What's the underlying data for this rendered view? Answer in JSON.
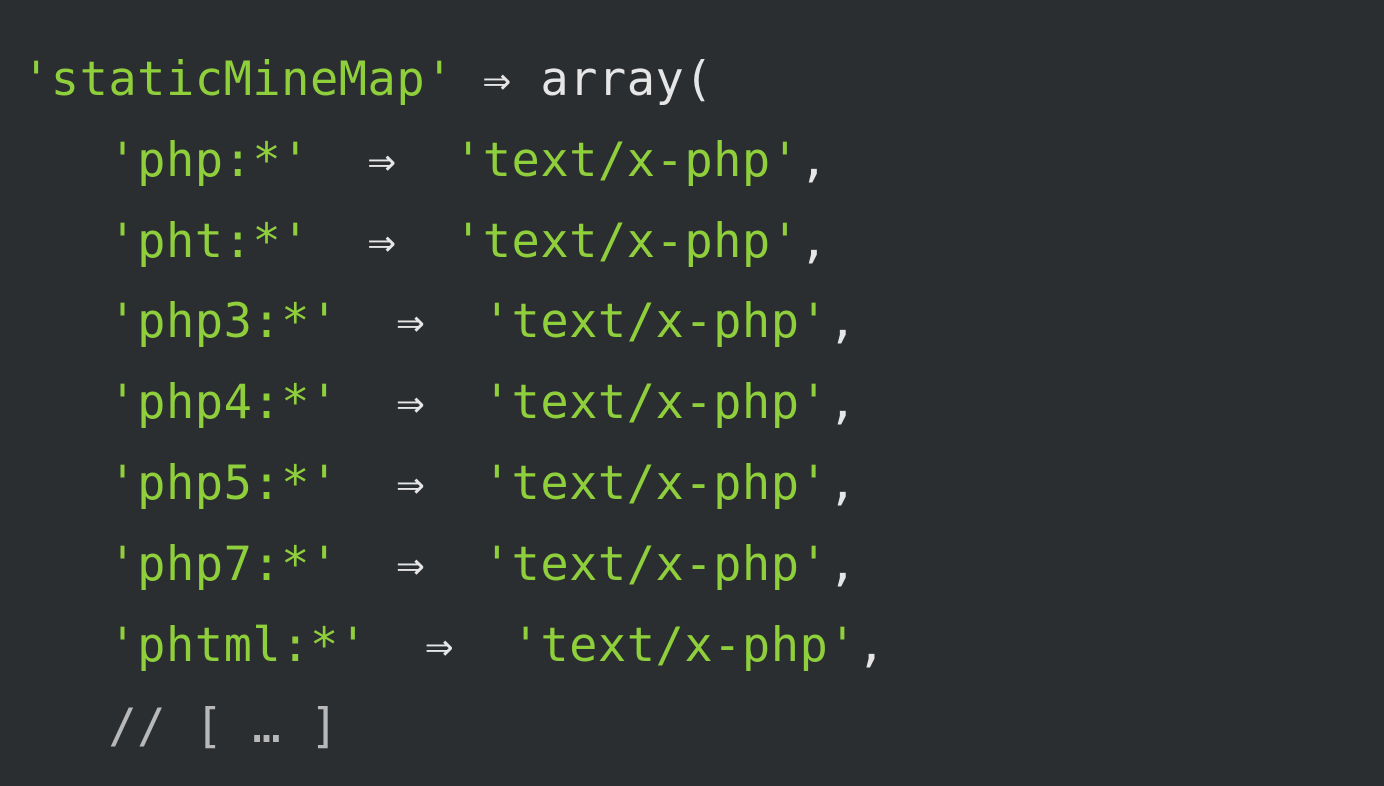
{
  "code": {
    "key": "'staticMineMap'",
    "arrow": "⇒",
    "array_kw": "array",
    "open_paren": "(",
    "entries": [
      {
        "k": "'php:*'",
        "v": "'text/x-php'"
      },
      {
        "k": "'pht:*'",
        "v": "'text/x-php'"
      },
      {
        "k": "'php3:*'",
        "v": "'text/x-php'"
      },
      {
        "k": "'php4:*'",
        "v": "'text/x-php'"
      },
      {
        "k": "'php5:*'",
        "v": "'text/x-php'"
      },
      {
        "k": "'php7:*'",
        "v": "'text/x-php'"
      },
      {
        "k": "'phtml:*'",
        "v": "'text/x-php'"
      }
    ],
    "comment": "// [ … ]"
  }
}
